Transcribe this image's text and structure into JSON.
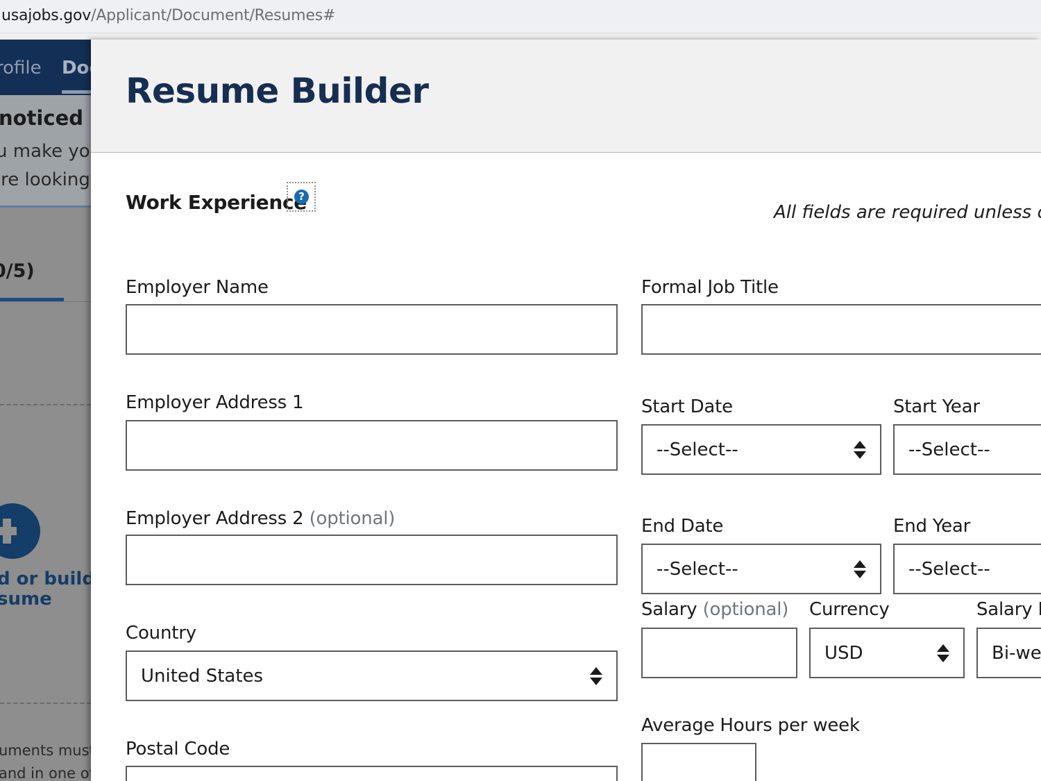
{
  "browser": {
    "url_host": "usajobs.gov",
    "url_path": "/Applicant/Document/Resumes#"
  },
  "background_page": {
    "nav": {
      "profile": "rofile",
      "documents": "Doc"
    },
    "alert": {
      "title": "noticed by",
      "line1": "u make you",
      "line2": "'re looking t"
    },
    "counter": "0/5)",
    "upload": {
      "line1": "d or build",
      "line2": "sume"
    },
    "footer": {
      "line1": "uments must",
      "line2": "and in one of"
    }
  },
  "modal": {
    "title": "Resume Builder",
    "section_title": "Work Experience",
    "help_symbol": "?",
    "required_note": "All fields are required unless otherwise noted",
    "fields": {
      "employer_name": {
        "label": "Employer Name",
        "value": ""
      },
      "formal_job_title": {
        "label": "Formal Job Title",
        "value": ""
      },
      "employer_address_1": {
        "label": "Employer Address 1",
        "value": ""
      },
      "employer_address_2": {
        "label": "Employer Address 2",
        "optional": "(optional)",
        "value": ""
      },
      "country": {
        "label": "Country",
        "value": "United States"
      },
      "postal_code": {
        "label": "Postal Code",
        "value": ""
      },
      "start_date": {
        "label": "Start Date",
        "value": "--Select--"
      },
      "start_year": {
        "label": "Start Year",
        "value": "--Select--"
      },
      "end_date": {
        "label": "End Date",
        "value": "--Select--"
      },
      "end_year": {
        "label": "End Year",
        "value": "--Select--"
      },
      "salary": {
        "label": "Salary",
        "optional": "(optional)",
        "value": ""
      },
      "currency": {
        "label": "Currency",
        "value": "USD"
      },
      "salary_rate": {
        "label": "Salary R",
        "value": "Bi-wee"
      },
      "average_hours": {
        "label": "Average Hours per week",
        "value": ""
      }
    }
  }
}
